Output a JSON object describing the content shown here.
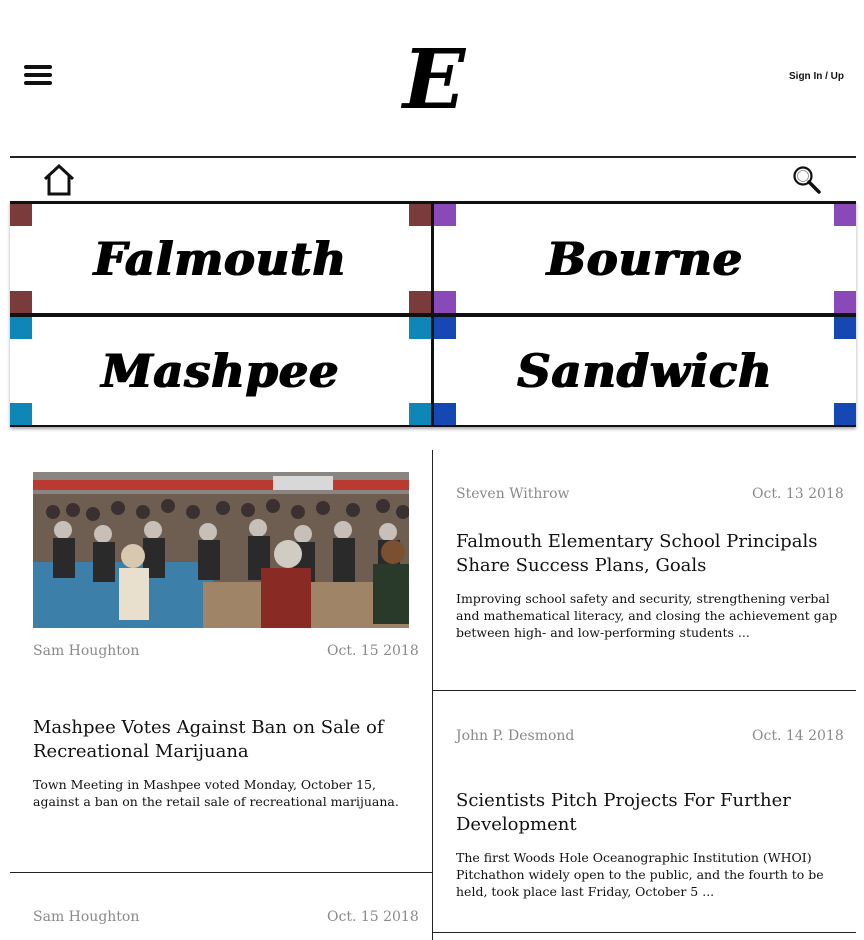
{
  "header": {
    "logo_letter": "E",
    "sign_in_label": "Sign In / Up"
  },
  "towns": [
    {
      "name": "Falmouth",
      "color": "#7b3b3b"
    },
    {
      "name": "Bourne",
      "color": "#8a49b8"
    },
    {
      "name": "Mashpee",
      "color": "#0f86b8"
    },
    {
      "name": "Sandwich",
      "color": "#1648b4"
    }
  ],
  "articles": [
    {
      "author": "Sam Houghton",
      "date": "Oct. 15 2018",
      "headline": "Mashpee Votes Against Ban on Sale of Recreational Marijuana",
      "summary": "Town Meeting in Mashpee voted Monday, October 15, against a ban on the retail sale of recreational marijuana."
    },
    {
      "author": "Steven Withrow",
      "date": "Oct. 13 2018",
      "headline": "Falmouth Elementary School Principals Share Success Plans, Goals",
      "summary": "Improving school safety and security, strengthening verbal and mathematical literacy, and closing the achievement gap between high- and low-performing students ..."
    },
    {
      "author": "John P. Desmond",
      "date": "Oct. 14 2018",
      "headline": "Scientists Pitch Projects For Further Development",
      "summary": "The first Woods Hole Oceanographic Institution (WHOI) Pitchathon widely open to the public, and the fourth to be held, took place last Friday, October 5 ..."
    },
    {
      "author": "Sam Houghton",
      "date": "Oct. 15 2018"
    }
  ]
}
